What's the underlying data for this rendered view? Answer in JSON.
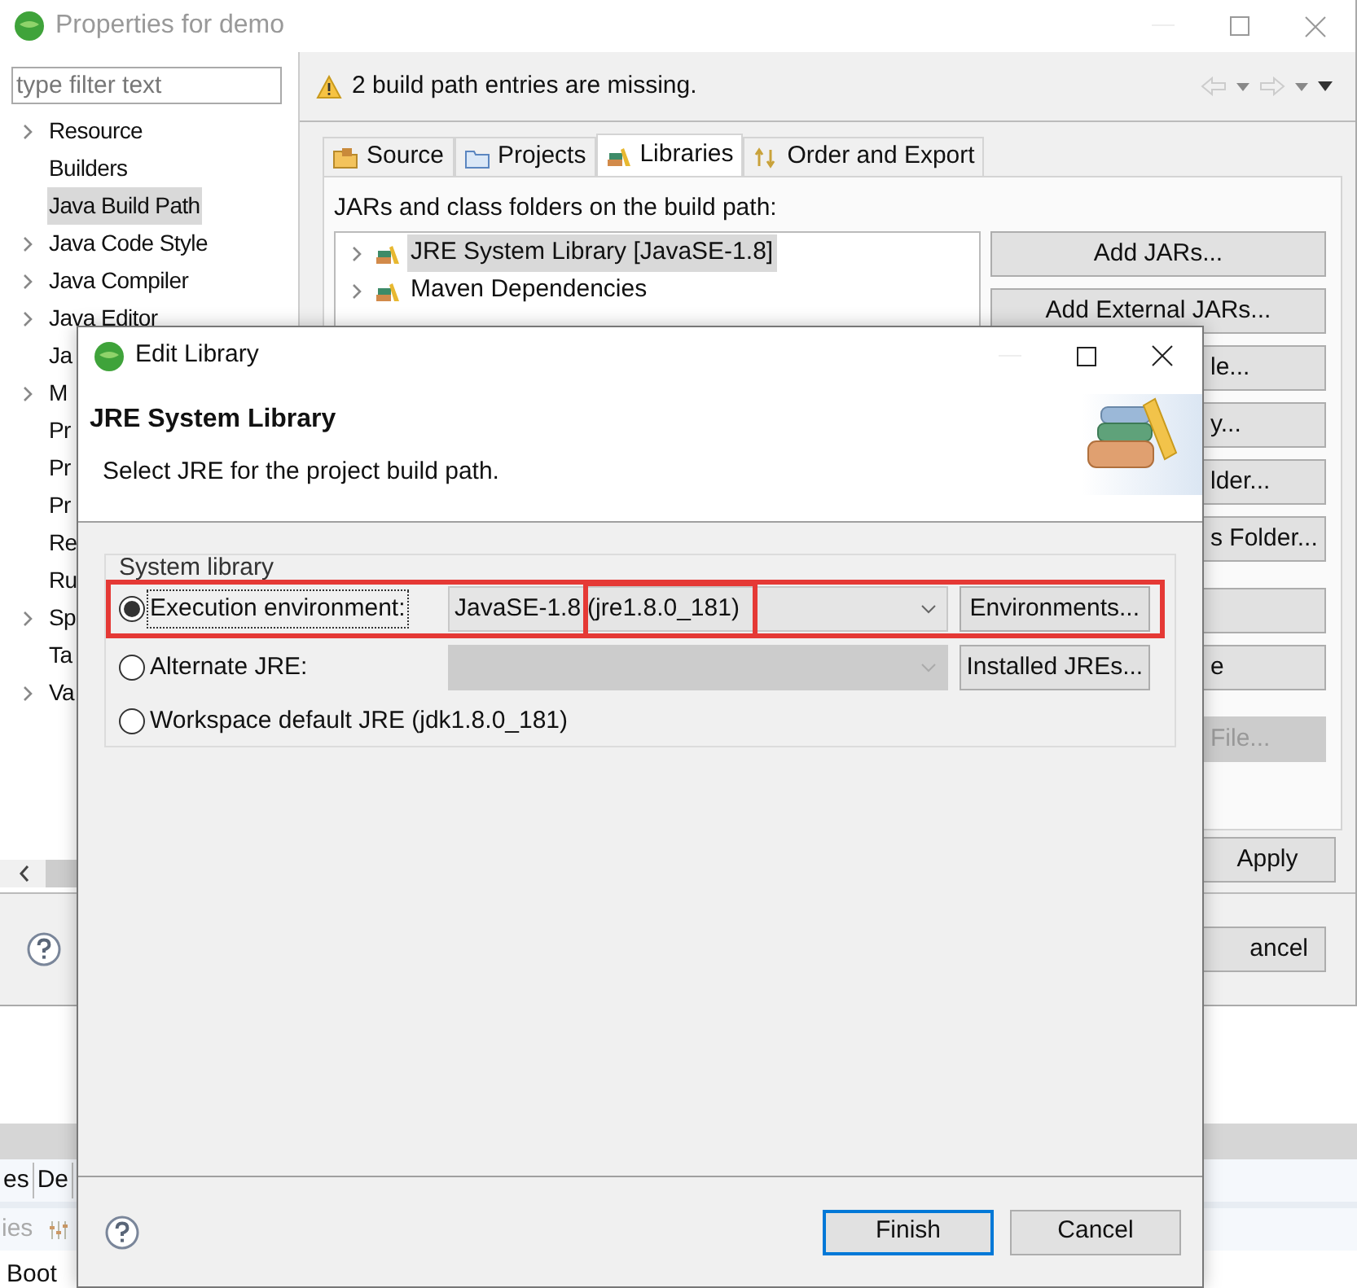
{
  "properties_window": {
    "title": "Properties for demo",
    "filter": {
      "placeholder": "type filter text"
    },
    "tree": [
      {
        "label": "Resource",
        "expandable": true,
        "selected": false
      },
      {
        "label": "Builders",
        "expandable": false,
        "selected": false
      },
      {
        "label": "Java Build Path",
        "expandable": false,
        "selected": true
      },
      {
        "label": "Java Code Style",
        "expandable": true,
        "selected": false
      },
      {
        "label": "Java Compiler",
        "expandable": true,
        "selected": false
      },
      {
        "label": "Java Editor",
        "expandable": true,
        "selected": false
      },
      {
        "label": "Ja",
        "expandable": false,
        "selected": false
      },
      {
        "label": "M",
        "expandable": true,
        "selected": false
      },
      {
        "label": "Pr",
        "expandable": false,
        "selected": false
      },
      {
        "label": "Pr",
        "expandable": false,
        "selected": false
      },
      {
        "label": "Pr",
        "expandable": false,
        "selected": false
      },
      {
        "label": "Re",
        "expandable": false,
        "selected": false
      },
      {
        "label": "Ru",
        "expandable": false,
        "selected": false
      },
      {
        "label": "Sp",
        "expandable": true,
        "selected": false
      },
      {
        "label": "Ta",
        "expandable": false,
        "selected": false
      },
      {
        "label": "Va",
        "expandable": true,
        "selected": false
      }
    ],
    "message": "2 build path entries are missing.",
    "tabs": [
      {
        "label": "Source",
        "kind": "source",
        "selected": false
      },
      {
        "label": "Projects",
        "kind": "projects",
        "selected": false
      },
      {
        "label": "Libraries",
        "kind": "libraries",
        "selected": true
      },
      {
        "label": "Order and Export",
        "kind": "order",
        "selected": false
      }
    ],
    "list_caption": "JARs and class folders on the build path:",
    "libraries": [
      {
        "label": "JRE System Library [JavaSE-1.8]",
        "selected": true
      },
      {
        "label": "Maven Dependencies",
        "selected": false
      }
    ],
    "side_buttons": [
      {
        "label": "Add JARs...",
        "disabled": false,
        "clipped": false
      },
      {
        "label": "Add External JARs...",
        "disabled": false,
        "clipped": false
      },
      {
        "label": "le...",
        "disabled": false,
        "clipped": true
      },
      {
        "label": "y...",
        "disabled": false,
        "clipped": true
      },
      {
        "label": "lder...",
        "disabled": false,
        "clipped": true
      },
      {
        "label": "s Folder...",
        "disabled": false,
        "clipped": true
      },
      {
        "disabled": false
      },
      {
        "label": "e",
        "disabled": false,
        "clipped": true
      },
      {
        "label": "File...",
        "disabled": true,
        "clipped": true
      }
    ],
    "apply_button": "Apply",
    "cancel_button": "ancel"
  },
  "workbench": {
    "tabs": [
      {
        "label": "es",
        "selected": false
      },
      {
        "label": "De",
        "selected": false
      }
    ],
    "toolbar_label": "ies",
    "row_text": "Boot"
  },
  "dialog": {
    "title": "Edit Library",
    "heading": "JRE System Library",
    "description": "Select JRE for the project build path.",
    "group_label": "System library",
    "options": [
      {
        "label": "Execution environment:",
        "selected": true,
        "focused": true,
        "highlighted": true,
        "combo": {
          "disabled": false,
          "value_parts": [
            {
              "text": "JavaSE-1.8",
              "highlighted": false
            },
            {
              "text": "(jre1.8.0_181)",
              "highlighted": true
            }
          ]
        },
        "button": "Environments..."
      },
      {
        "label": "Alternate JRE:",
        "selected": false,
        "focused": false,
        "highlighted": false,
        "combo": {
          "disabled": true
        },
        "button": "Installed JREs..."
      },
      {
        "label": "Workspace default JRE (jdk1.8.0_181)",
        "selected": false,
        "focused": false,
        "highlighted": false
      }
    ],
    "buttons": [
      {
        "label": "Finish",
        "default": true
      },
      {
        "label": "Cancel",
        "default": false
      }
    ]
  }
}
